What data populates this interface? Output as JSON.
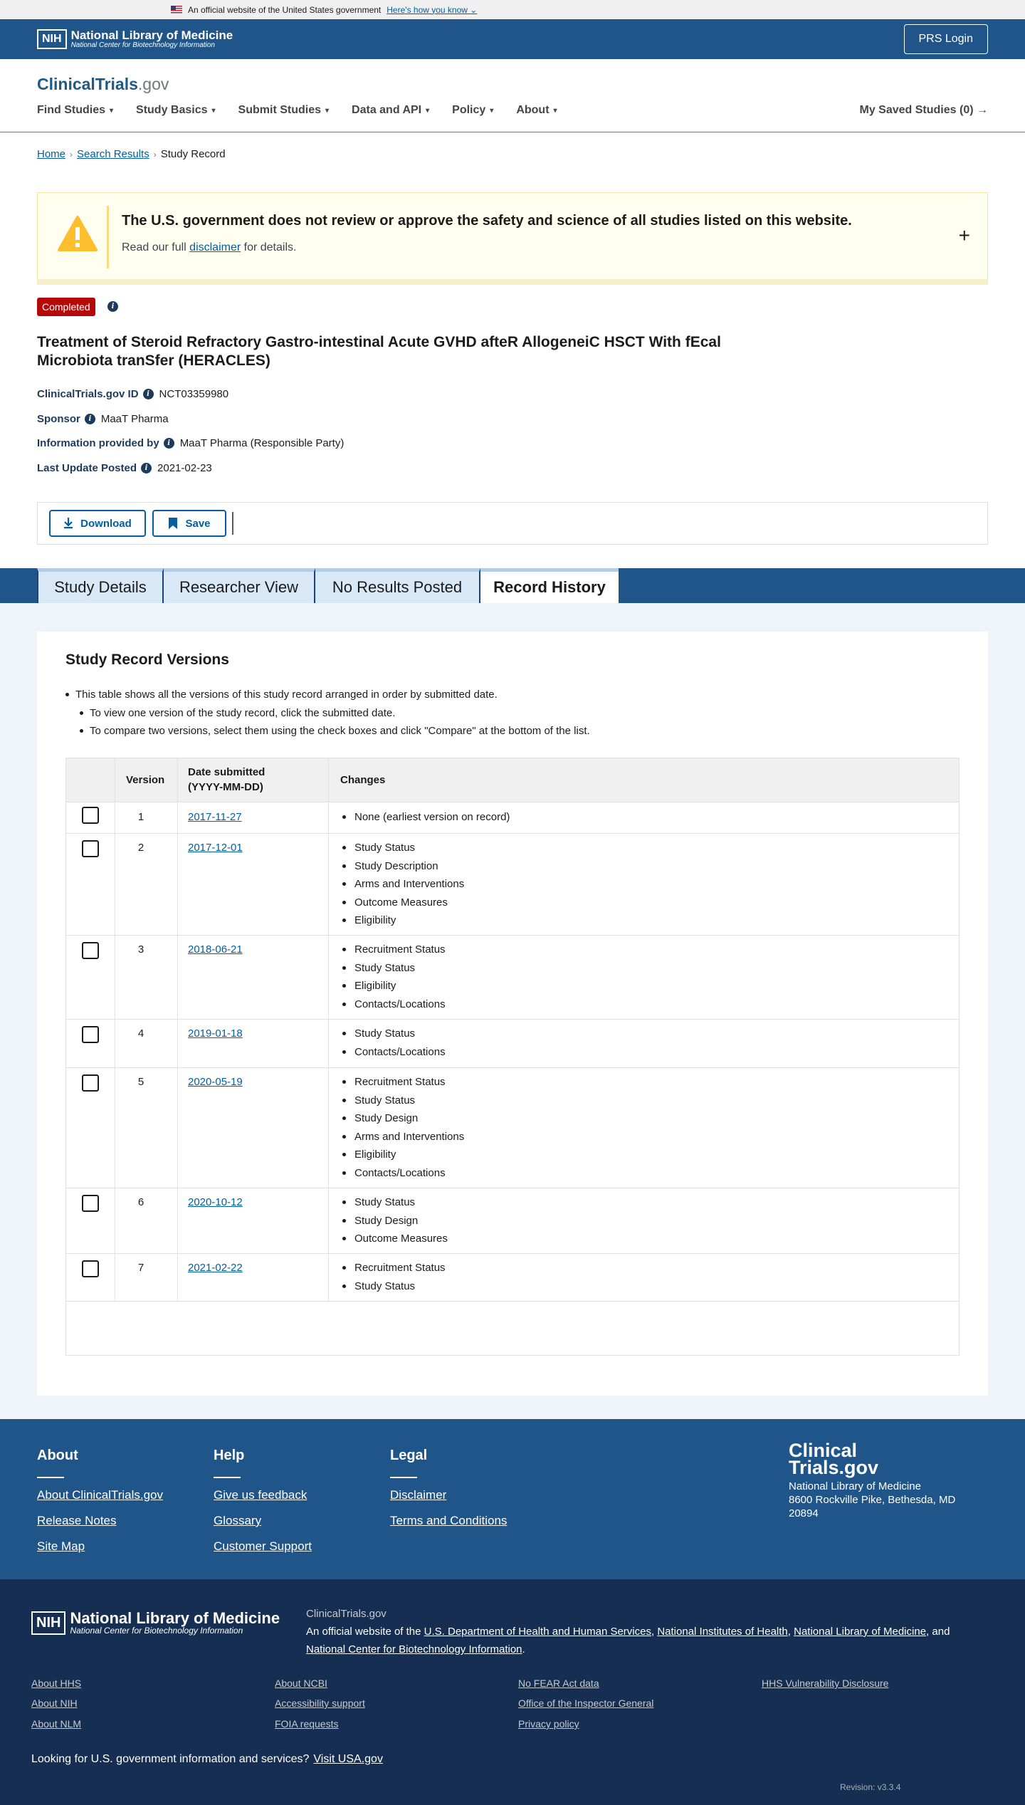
{
  "gov_banner": {
    "text": "An official website of the United States government",
    "link": "Here's how you know"
  },
  "nih_header": {
    "logo_box": "NIH",
    "title": "National Library of Medicine",
    "subtitle": "National Center for Biotechnology Information",
    "prs_login": "PRS Login"
  },
  "site": {
    "logo_main": "ClinicalTrials",
    "logo_suffix": ".gov",
    "nav": [
      "Find Studies",
      "Study Basics",
      "Submit Studies",
      "Data and API",
      "Policy",
      "About"
    ],
    "saved_studies": "My Saved Studies (0)"
  },
  "breadcrumb": {
    "home": "Home",
    "search": "Search Results",
    "current": "Study Record"
  },
  "alert": {
    "title": "The U.S. government does not review or approve the safety and science of all studies listed on this website.",
    "pre": "Read our full",
    "link": "disclaimer",
    "post": "for details."
  },
  "study": {
    "status": "Completed",
    "title": "Treatment of Steroid Refractory Gastro-intestinal Acute GVHD afteR AllogeneiC HSCT With fEcal Microbiota tranSfer (HERACLES)",
    "id_label": "ClinicalTrials.gov ID",
    "id_value": "NCT03359980",
    "sponsor_label": "Sponsor",
    "sponsor_value": "MaaT Pharma",
    "info_label": "Information provided by",
    "info_value": "MaaT Pharma (Responsible Party)",
    "update_label": "Last Update Posted",
    "update_value": "2021-02-23"
  },
  "actions": {
    "download": "Download",
    "save": "Save"
  },
  "tabs": [
    "Study Details",
    "Researcher View",
    "No Results Posted",
    "Record History"
  ],
  "versions": {
    "heading": "Study Record Versions",
    "bullet_main": "This table shows all the versions of this study record arranged in order by submitted date.",
    "bullet_sub1": "To view one version of the study record, click the submitted date.",
    "bullet_sub2": "To compare two versions, select them using the check boxes and click \"Compare\" at the bottom of the list.",
    "col_version": "Version",
    "col_date_1": "Date submitted",
    "col_date_2": "(YYYY-MM-DD)",
    "col_changes": "Changes",
    "rows": [
      {
        "version": "1",
        "date": "2017-11-27",
        "changes": [
          "None (earliest version on record)"
        ]
      },
      {
        "version": "2",
        "date": "2017-12-01",
        "changes": [
          "Study Status",
          "Study Description",
          "Arms and Interventions",
          "Outcome Measures",
          "Eligibility"
        ]
      },
      {
        "version": "3",
        "date": "2018-06-21",
        "changes": [
          "Recruitment Status",
          "Study Status",
          "Eligibility",
          "Contacts/Locations"
        ]
      },
      {
        "version": "4",
        "date": "2019-01-18",
        "changes": [
          "Study Status",
          "Contacts/Locations"
        ]
      },
      {
        "version": "5",
        "date": "2020-05-19",
        "changes": [
          "Recruitment Status",
          "Study Status",
          "Study Design",
          "Arms and Interventions",
          "Eligibility",
          "Contacts/Locations"
        ]
      },
      {
        "version": "6",
        "date": "2020-10-12",
        "changes": [
          "Study Status",
          "Study Design",
          "Outcome Measures"
        ]
      },
      {
        "version": "7",
        "date": "2021-02-22",
        "changes": [
          "Recruitment Status",
          "Study Status"
        ]
      }
    ]
  },
  "footer": {
    "about": {
      "heading": "About",
      "links": [
        "About ClinicalTrials.gov",
        "Release Notes",
        "Site Map"
      ]
    },
    "help": {
      "heading": "Help",
      "links": [
        "Give us feedback",
        "Glossary",
        "Customer Support"
      ]
    },
    "legal": {
      "heading": "Legal",
      "links": [
        "Disclaimer",
        "Terms and Conditions"
      ]
    },
    "logo_line1": "Clinical",
    "logo_line2": "Trials.gov",
    "address_1": "National Library of Medicine",
    "address_2": "8600 Rockville Pike, Bethesda, MD",
    "address_3": "20894"
  },
  "footer_bottom": {
    "logo_box": "NIH",
    "title": "National Library of Medicine",
    "subtitle": "National Center for Biotechnology Information",
    "site": "ClinicalTrials.gov",
    "official_pre": "An official website of the",
    "hhs": "U.S. Department of Health and Human Services",
    "nih": "National Institutes of Health",
    "nlm": "National Library of Medicine",
    "and": "and",
    "ncbi": "National Center for Biotechnology Information",
    "links": [
      [
        "About HHS",
        "About NIH",
        "About NLM"
      ],
      [
        "About NCBI",
        "Accessibility support",
        "FOIA requests"
      ],
      [
        "No FEAR Act data",
        "Office of the Inspector General",
        "Privacy policy"
      ],
      [
        "HHS Vulnerability Disclosure"
      ]
    ],
    "looking": "Looking for U.S. government information and services?",
    "usa_gov": "Visit USA.gov",
    "revision": "Revision: v3.3.4"
  }
}
